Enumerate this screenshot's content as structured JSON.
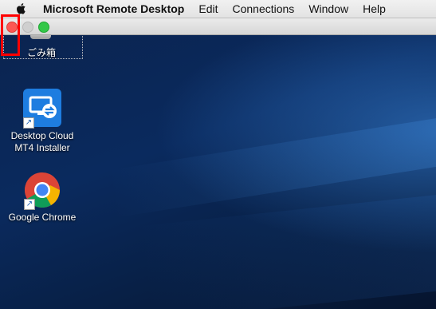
{
  "menubar": {
    "app_name": "Microsoft Remote Desktop",
    "items": [
      "Edit",
      "Connections",
      "Window",
      "Help"
    ]
  },
  "window": {
    "controls": [
      "close",
      "minimize",
      "maximize"
    ]
  },
  "desktop": {
    "icons": [
      {
        "label": "ごみ箱",
        "icon": "trash-icon"
      },
      {
        "label_line1": "Desktop Cloud",
        "label_line2": "MT4 Installer",
        "icon": "remote-desktop-app-icon"
      },
      {
        "label": "Google Chrome",
        "icon": "chrome-icon"
      }
    ]
  },
  "colors": {
    "close": "#fc5753",
    "maximize": "#33c748",
    "highlight": "#ff0000",
    "app_icon_blue": "#1e7de0"
  }
}
